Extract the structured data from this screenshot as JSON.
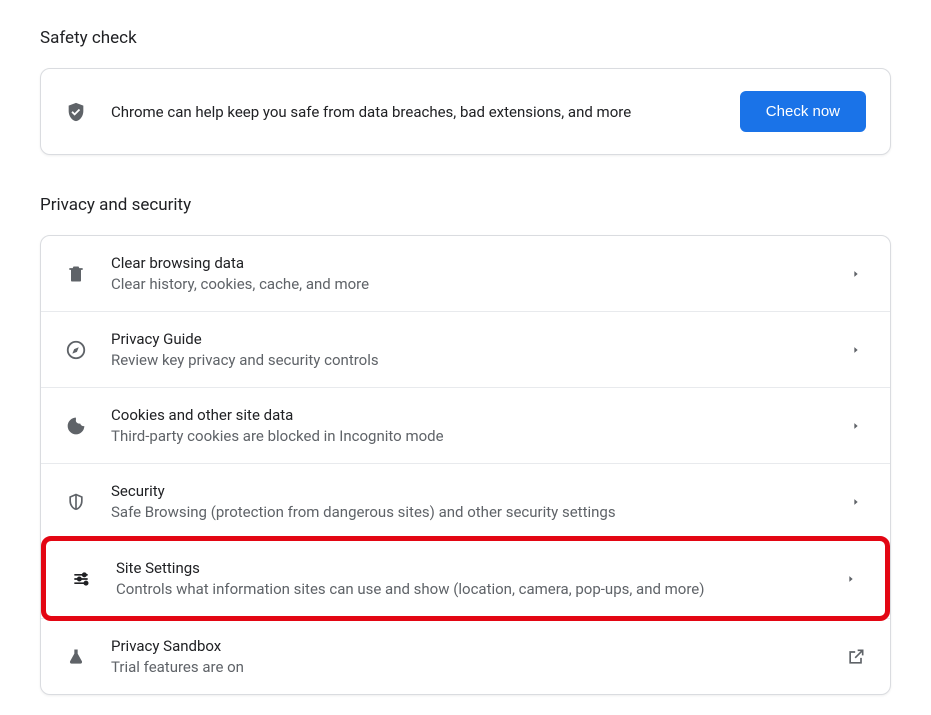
{
  "safety": {
    "heading": "Safety check",
    "text": "Chrome can help keep you safe from data breaches, bad extensions, and more",
    "button": "Check now"
  },
  "privacy": {
    "heading": "Privacy and security",
    "items": [
      {
        "title": "Clear browsing data",
        "desc": "Clear history, cookies, cache, and more"
      },
      {
        "title": "Privacy Guide",
        "desc": "Review key privacy and security controls"
      },
      {
        "title": "Cookies and other site data",
        "desc": "Third-party cookies are blocked in Incognito mode"
      },
      {
        "title": "Security",
        "desc": "Safe Browsing (protection from dangerous sites) and other security settings"
      },
      {
        "title": "Site Settings",
        "desc": "Controls what information sites can use and show (location, camera, pop-ups, and more)"
      },
      {
        "title": "Privacy Sandbox",
        "desc": "Trial features are on"
      }
    ]
  }
}
